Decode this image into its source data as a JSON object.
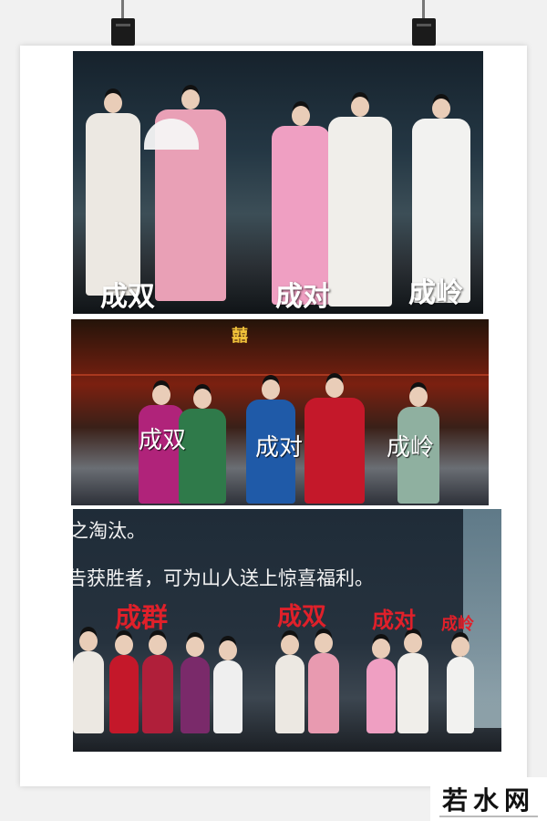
{
  "panel_top": {
    "labels": [
      "成双",
      "成对",
      "成岭"
    ]
  },
  "panel_middle": {
    "labels": [
      "成双",
      "成对",
      "成岭"
    ],
    "backdrop_char": "囍"
  },
  "panel_bottom": {
    "screen_lines": [
      "之淘汰。",
      "告获胜者，可为山人送上惊喜福利。"
    ],
    "labels": [
      "成群",
      "成双",
      "成对",
      "成岭"
    ]
  },
  "watermark": {
    "text": "若水网"
  },
  "colors": {
    "label_white": "#ffffff",
    "label_red": "#e0202a",
    "pink_robe": "#e89ab0",
    "white_robe": "#ece8e2",
    "blue_robe": "#1f5aa8",
    "red_robe": "#c4182a",
    "green_robe": "#2f7a4a",
    "magenta_robe": "#b0237a",
    "sage_robe": "#8fb0a0"
  }
}
